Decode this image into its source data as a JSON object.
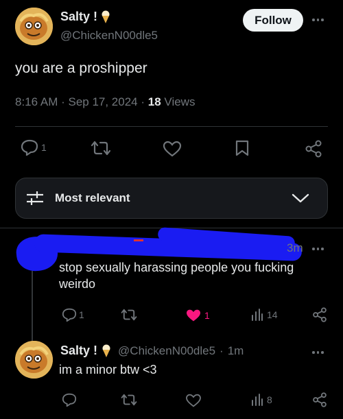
{
  "post": {
    "display_name": "Salty !",
    "handle": "@ChickenN00dle5",
    "follow_label": "Follow",
    "text": "you are a proshipper",
    "time": "8:16 AM",
    "date": "Sep 17, 2024",
    "views_count": "18",
    "views_label": "Views",
    "reply_count": "1"
  },
  "sort": {
    "label": "Most relevant"
  },
  "replies": [
    {
      "time": "3m",
      "text": "stop sexually harassing people you fucking weirdo",
      "reply_count": "1",
      "like_count": "1",
      "views": "14",
      "liked": true
    },
    {
      "display_name": "Salty !",
      "handle": "@ChickenN00dle5",
      "time": "1m",
      "text": "im a minor btw <3",
      "views": "8"
    }
  ],
  "colors": {
    "like_active": "#f91880",
    "redaction": "#1a1cf2",
    "muted": "#71767b"
  }
}
